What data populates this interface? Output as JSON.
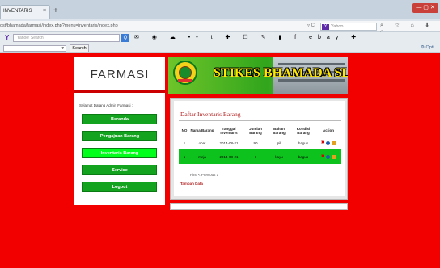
{
  "browser": {
    "tab_title": "INVENTARIS",
    "tab_close": "×",
    "new_tab": "+",
    "window_controls": "— ▢ ✕",
    "url": "ost/bhamada/farmasi/index.php?menu=inventaris/index.php",
    "url_controls": "▿ C",
    "search_engine_badge": "Y",
    "search_placeholder": "Yahoo",
    "nav_icons": "⌕ ☆ ⌂ ⬇ ⌂",
    "toolbar_logo": "Y",
    "toolbar_search_placeholder": "Yahoo! Search",
    "toolbar_go": "Q",
    "toolbar_icons": "✉ ◉ ☁ •• t ✚ ☐ ✎ ▮ f ebay ✚",
    "toolbar2_select": "▾",
    "toolbar2_search": "Search",
    "toolbar2_options": "⚙ Opti"
  },
  "sidebar": {
    "brand": "FARMASI",
    "welcome": "Selamat Datang Admin Farmasi :",
    "menu": [
      {
        "label": "Beranda",
        "active": false
      },
      {
        "label": "Pengajuan Barang",
        "active": false
      },
      {
        "label": "Inventaris Barang",
        "active": true
      },
      {
        "label": "Service",
        "active": false
      },
      {
        "label": "Logout",
        "active": false
      }
    ]
  },
  "banner": {
    "title": "STIKES BHAMADA SLAWI"
  },
  "content": {
    "title": "Daftar Inventaris Barang",
    "columns": [
      "NO",
      "Nama Barang",
      "Tanggal Inventaris",
      "Jumlah Barang",
      "Bahan Barang",
      "Kondisi Barang",
      "Action"
    ],
    "rows": [
      {
        "no": "1",
        "nama": "obat",
        "tanggal": "2014-08-21",
        "jumlah": "90",
        "bahan": "pil",
        "kondisi": "bagus"
      },
      {
        "no": "1",
        "nama": "meja",
        "tanggal": "2014-08-21",
        "jumlah": "1",
        "bahan": "kayu",
        "kondisi": "bagus"
      }
    ],
    "paging": "First < Previous 1",
    "add_link": "Tambah Data"
  },
  "colors": {
    "page_background": "#f20000",
    "menu_button": "#13a31f",
    "menu_active": "#00ff1a",
    "highlight_row": "#0ec21d",
    "title_red": "#b22222"
  }
}
